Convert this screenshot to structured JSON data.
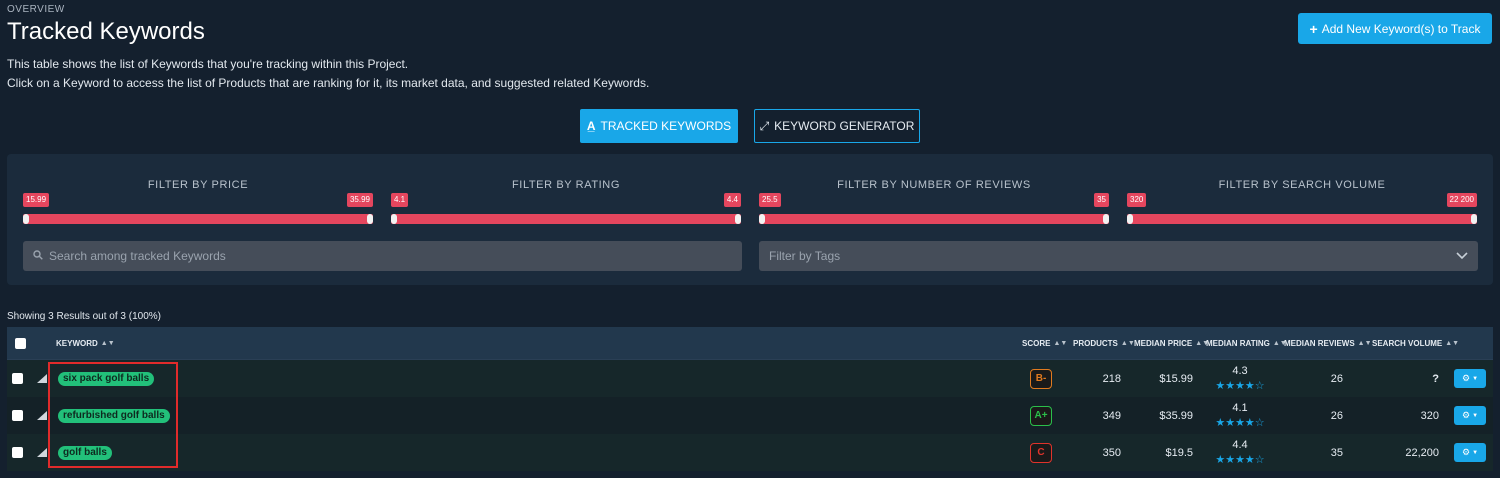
{
  "header": {
    "overview": "OVERVIEW",
    "title": "Tracked Keywords",
    "desc1": "This table shows the list of Keywords that you're tracking within this Project.",
    "desc2": "Click on a Keyword to access the list of Products that are ranking for it, its market data, and suggested related Keywords.",
    "add_button": "Add New Keyword(s) to Track"
  },
  "modes": {
    "tracked": "TRACKED KEYWORDS",
    "generator": "KEYWORD GENERATOR"
  },
  "filters": [
    {
      "label": "FILTER BY PRICE",
      "min": "15.99",
      "max": "35.99"
    },
    {
      "label": "FILTER BY RATING",
      "min": "4.1",
      "max": "4.4"
    },
    {
      "label": "FILTER BY NUMBER OF REVIEWS",
      "min": "25.5",
      "max": "35"
    },
    {
      "label": "FILTER BY SEARCH VOLUME",
      "min": "320",
      "max": "22 200"
    }
  ],
  "search": {
    "placeholder": "Search among tracked Keywords"
  },
  "tags_filter": {
    "placeholder": "Filter by Tags"
  },
  "showing": "Showing 3 Results out of 3 (100%)",
  "table": {
    "headers": {
      "keyword": "KEYWORD",
      "score": "SCORE",
      "products": "PRODUCTS",
      "median_price": "MEDIAN PRICE",
      "median_rating": "MEDIAN RATING",
      "median_reviews": "MEDIAN REVIEWS",
      "search_volume": "SEARCH VOLUME"
    },
    "rows": [
      {
        "keyword": "six pack golf balls",
        "score": "B-",
        "products": "218",
        "price": "$15.99",
        "rating": "4.3",
        "stars": "★★★★☆",
        "reviews": "26",
        "volume": "?"
      },
      {
        "keyword": "refurbished golf balls",
        "score": "A+",
        "products": "349",
        "price": "$35.99",
        "rating": "4.1",
        "stars": "★★★★☆",
        "reviews": "26",
        "volume": "320"
      },
      {
        "keyword": "golf balls",
        "score": "C",
        "products": "350",
        "price": "$19.5",
        "rating": "4.4",
        "stars": "★★★★☆",
        "reviews": "35",
        "volume": "22,200"
      }
    ]
  },
  "colors": {
    "accent": "#19a7e8",
    "slider": "#e5465e",
    "keyword_pill": "#22c07a",
    "score_b": "#e07a1f",
    "score_a": "#2bbf4a",
    "score_c": "#e0332b"
  }
}
